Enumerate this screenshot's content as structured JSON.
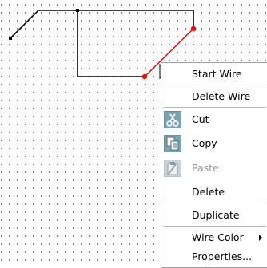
{
  "context_menu": {
    "items": [
      {
        "label": "Start Wire",
        "icon": null,
        "enabled": true
      },
      {
        "label": "Delete Wire",
        "icon": null,
        "enabled": true
      },
      {
        "label": "Cut",
        "icon": "scissors-icon",
        "enabled": true
      },
      {
        "label": "Copy",
        "icon": "copy-icon",
        "enabled": true
      },
      {
        "label": "Paste",
        "icon": "paste-icon",
        "enabled": false
      },
      {
        "label": "Delete",
        "icon": null,
        "enabled": true
      },
      {
        "label": "Duplicate",
        "icon": null,
        "enabled": true
      },
      {
        "label": "Wire Color",
        "icon": null,
        "enabled": true,
        "submenu": true
      },
      {
        "label": "Properties...",
        "icon": null,
        "enabled": true
      }
    ]
  },
  "colors": {
    "wire": "#000000",
    "selected_wire": "#ff0000",
    "grid_dot": "#555555",
    "icon_fill": "#6a8fa0"
  }
}
